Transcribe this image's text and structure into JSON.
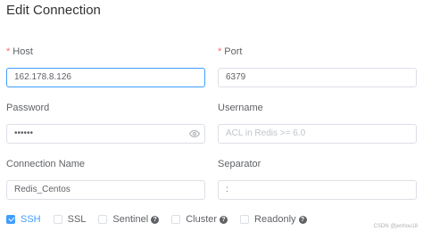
{
  "dialog": {
    "title": "Edit Connection"
  },
  "fields": {
    "host": {
      "label": "Host",
      "value": "162.178.8.126"
    },
    "port": {
      "label": "Port",
      "value": "6379"
    },
    "password": {
      "label": "Password",
      "value": "••••••"
    },
    "username": {
      "label": "Username",
      "placeholder": "ACL in Redis >= 6.0"
    },
    "connection_name": {
      "label": "Connection Name",
      "value": "Redis_Centos"
    },
    "separator": {
      "label": "Separator",
      "value": ":"
    }
  },
  "options": {
    "ssh": {
      "label": "SSH",
      "checked": true
    },
    "ssl": {
      "label": "SSL",
      "checked": false
    },
    "sentinel": {
      "label": "Sentinel",
      "checked": false
    },
    "cluster": {
      "label": "Cluster",
      "checked": false
    },
    "readonly": {
      "label": "Readonly",
      "checked": false
    },
    "help_glyph": "?"
  },
  "required_mark": "*",
  "colors": {
    "accent": "#409eff",
    "required": "#f56c6c"
  },
  "icons": {
    "password_toggle": "eye-icon"
  },
  "watermark": "CSDN @jenhou18"
}
